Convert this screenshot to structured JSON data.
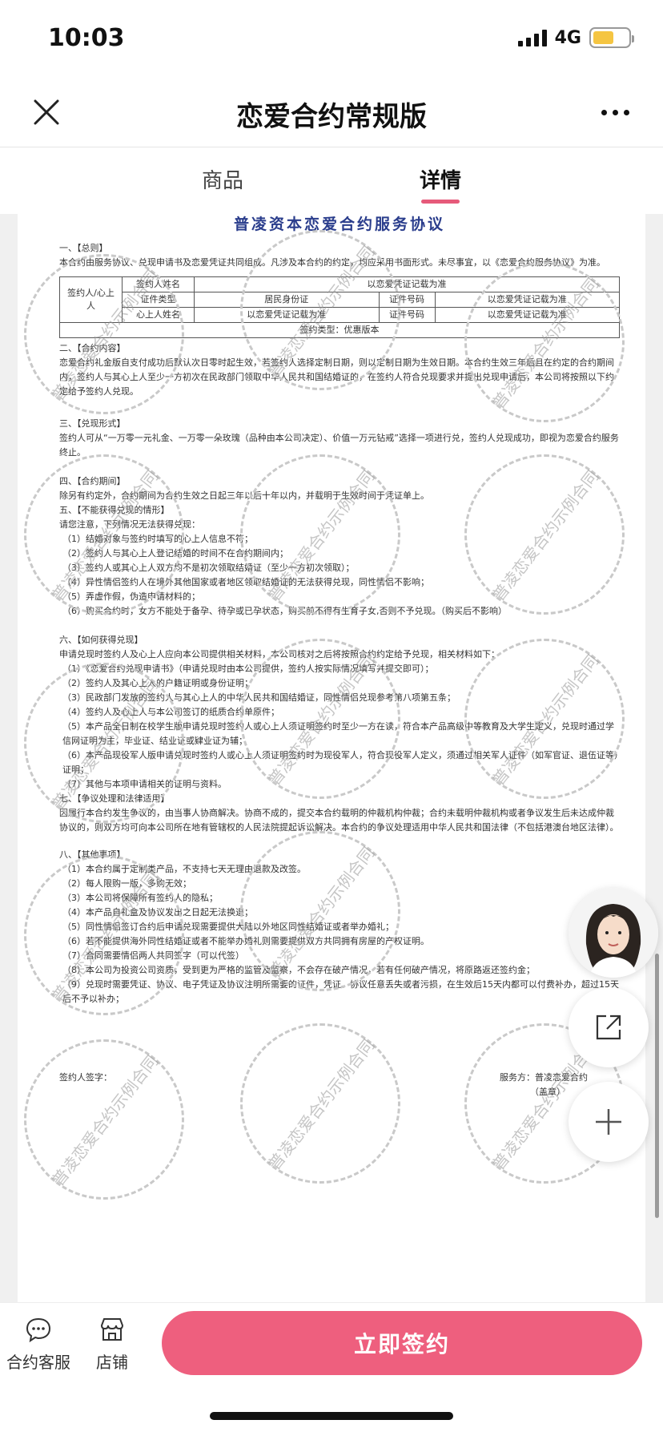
{
  "status_bar": {
    "time": "10:03",
    "network": "4G",
    "battery_level": 0.6,
    "battery_color": "#f5c542"
  },
  "nav": {
    "title": "恋爱合约常规版",
    "close_icon": "close-icon",
    "more_icon": "more-icon"
  },
  "tabs": [
    {
      "label": "商品",
      "active": false
    },
    {
      "label": "详情",
      "active": true
    }
  ],
  "document": {
    "title": "普凌资本恋爱合约服务协议",
    "watermark": "普凌恋爱合约示例合同",
    "sec1": {
      "title": "一、【总则】",
      "text": "本合约由服务协议、兑现申请书及恋爱凭证共同组成。凡涉及本合约的约定，均应采用书面形式。未尽事宜，以《恋爱合约服务协议》为准。"
    },
    "table": {
      "c_party1": "签约人/心上人",
      "c_name": "签约人姓名",
      "c_name_val": "以恋爱凭证记载为准",
      "c_idtype": "证件类型",
      "c_idtype_val": "居民身份证",
      "c_idno": "证件号码",
      "c_idno_val": "以恋爱凭证记载为准",
      "c_lover": "心上人姓名",
      "c_lover_val": "以恋爱凭证记载为准",
      "c_idno2": "证件号码",
      "c_idno2_val": "以恋爱凭证记载为准",
      "c_type": "签约类型：优惠版本"
    },
    "sec2": {
      "title": "二、【合约内容】",
      "text": "恋爱合约礼金版自支付成功后默认次日零时起生效，若签约人选择定制日期，则以定制日期为生效日期。本合约生效三年后且在约定的合约期间内，签约人与其心上人至少一方初次在民政部门领取中华人民共和国结婚证的，在签约人符合兑现要求并提出兑现申请后，本公司将按照以下约定给予签约人兑现。"
    },
    "sec3": {
      "title": "三、【兑现形式】",
      "text": "签约人可从“一万零一元礼金、一万零一朵玫瑰（品种由本公司决定）、价值一万元钻戒”选择一项进行兑，签约人兑现成功，即视为恋爱合约服务终止。"
    },
    "sec4": {
      "title": "四、【合约期间】",
      "text": "除另有约定外，合约期间为合约生效之日起三年以后十年以内，并载明于生效时间于凭证单上。"
    },
    "sec5": {
      "title": "五、【不能获得兑现的情形】",
      "intro": "请您注意，下列情况无法获得兑现：",
      "items": [
        "（1）结婚对象与签约时填写的心上人信息不符；",
        "（2）签约人与其心上人登记结婚的时间不在合约期间内；",
        "（3）签约人或其心上人双方均不是初次领取结婚证（至少一方初次领取）；",
        "（4）异性情侣签约人在境外其他国家或者地区领取结婚证的无法获得兑现，同性情侣不影响；",
        "（5）弄虚作假，伪造申请材料的；",
        "（6）购买合约时，女方不能处于备孕、待孕或已孕状态，购买前不得有生育子女,否则不予兑现。（购买后不影响）"
      ]
    },
    "sec6": {
      "title": "六、【如何获得兑现】",
      "intro": "申请兑现时签约人及心上人应向本公司提供相关材料，本公司核对之后将按照合约约定给予兑现，相关材料如下：",
      "items": [
        "（1）《恋爱合约兑现申请书》（申请兑现时由本公司提供，签约人按实际情况填写并提交即可）；",
        "（2）签约人及其心上人的户籍证明或身份证明；",
        "（3）民政部门发放的签约人与其心上人的中华人民共和国结婚证，同性情侣兑现参考第八项第五条；",
        "（4）签约人及心上人与本公司签订的纸质合约单原件；",
        "（5）本产品全日制在校学生版申请兑现时签约人或心上人须证明签约时至少一方在读，符合本产品高级中等教育及大学生定义，兑现时通过学信网证明为主，毕业证、结业证或肄业证为辅；",
        "（6）本产品现役军人版申请兑现时签约人或心上人须证明签约时为现役军人，符合现役军人定义，须通过相关军人证件（如军官证、退伍证等）证明；",
        "（7）其他与本项申请相关的证明与资料。"
      ]
    },
    "sec7": {
      "title": "七、【争议处理和法律适用】",
      "text": "因履行本合约发生争议的，由当事人协商解决。协商不成的，提交本合约载明的仲裁机构仲裁；合约未载明仲裁机构或者争议发生后未达成仲裁协议的，则双方均可向本公司所在地有管辖权的人民法院提起诉讼解决。本合约的争议处理适用中华人民共和国法律（不包括港澳台地区法律）。"
    },
    "sec8": {
      "title": "八、【其他事项】",
      "items": [
        "（1）本合约属于定制类产品，不支持七天无理由退款及改签。",
        "（2）每人限购一版，多购无效；",
        "（3）本公司将保障所有签约人的隐私；",
        "（4）本产品自礼盒及协议发出之日起无法换退；",
        "（5）同性情侣签订合约后申请兑现需要提供大陆以外地区同性结婚证或者举办婚礼；",
        "（6）若不能提供海外同性结婚证或者不能举办婚礼则需要提供双方共同拥有房屋的产权证明。",
        "（7）合同需要情侣两人共同签字（可以代签）",
        "（8）本公司为投资公司资质，受到更为严格的监管及监察，不会存在破产情况，若有任何破产情况，将原路返还签约金；",
        "（9）兑现时需要凭证、协议、电子凭证及协议注明所需要的证件，凭证、协议任意丢失或者污损，在生效后15天内都可以付费补办，超过15天后不予以补办；"
      ]
    },
    "signer_label": "签约人签字：",
    "provider_label": "服务方：普凌恋爱合约",
    "stamp_label": "（盖章）"
  },
  "floating": {
    "avatar": "customer-service-avatar",
    "share_icon": "share-icon",
    "add_icon": "plus-icon"
  },
  "bottom_bar": {
    "service_label": "合约客服",
    "shop_label": "店铺",
    "sign_button": "立即签约",
    "accent": "#ee5f7e"
  }
}
